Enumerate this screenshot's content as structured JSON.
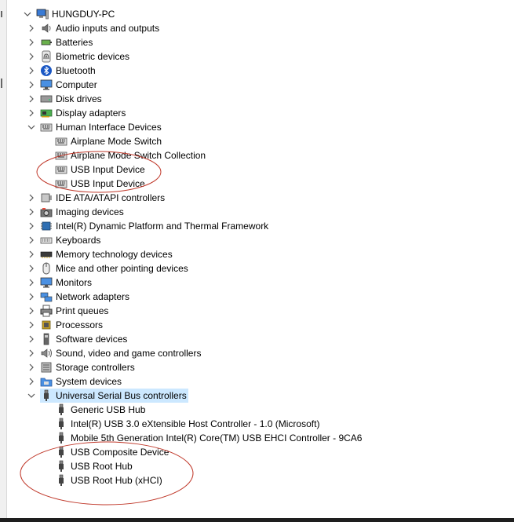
{
  "root": {
    "label": "HUNGDUY-PC",
    "icon": "computer-icon",
    "expanded": true
  },
  "categories": [
    {
      "label": "Audio inputs and outputs",
      "icon": "speaker-icon",
      "expanded": false
    },
    {
      "label": "Batteries",
      "icon": "battery-icon",
      "expanded": false
    },
    {
      "label": "Biometric devices",
      "icon": "fingerprint-icon",
      "expanded": false
    },
    {
      "label": "Bluetooth",
      "icon": "bluetooth-icon",
      "expanded": false
    },
    {
      "label": "Computer",
      "icon": "monitor-icon",
      "expanded": false
    },
    {
      "label": "Disk drives",
      "icon": "disk-drive-icon",
      "expanded": false
    },
    {
      "label": "Display adapters",
      "icon": "display-adapter-icon",
      "expanded": false
    },
    {
      "label": "Human Interface Devices",
      "icon": "hid-icon",
      "expanded": true,
      "children": [
        {
          "label": "Airplane Mode Switch",
          "icon": "hid-device-icon"
        },
        {
          "label": "Airplane Mode Switch Collection",
          "icon": "hid-device-icon"
        },
        {
          "label": "USB Input Device",
          "icon": "hid-device-icon"
        },
        {
          "label": "USB Input Device",
          "icon": "hid-device-icon"
        }
      ]
    },
    {
      "label": "IDE ATA/ATAPI controllers",
      "icon": "ide-controller-icon",
      "expanded": false
    },
    {
      "label": "Imaging devices",
      "icon": "camera-icon",
      "expanded": false
    },
    {
      "label": "Intel(R) Dynamic Platform and Thermal Framework",
      "icon": "chip-icon",
      "expanded": false
    },
    {
      "label": "Keyboards",
      "icon": "keyboard-icon",
      "expanded": false
    },
    {
      "label": "Memory technology devices",
      "icon": "memory-icon",
      "expanded": false
    },
    {
      "label": "Mice and other pointing devices",
      "icon": "mouse-icon",
      "expanded": false
    },
    {
      "label": "Monitors",
      "icon": "monitor-icon",
      "expanded": false
    },
    {
      "label": "Network adapters",
      "icon": "network-icon",
      "expanded": false
    },
    {
      "label": "Print queues",
      "icon": "printer-icon",
      "expanded": false
    },
    {
      "label": "Processors",
      "icon": "processor-icon",
      "expanded": false
    },
    {
      "label": "Software devices",
      "icon": "software-device-icon",
      "expanded": false
    },
    {
      "label": "Sound, video and game controllers",
      "icon": "sound-icon",
      "expanded": false
    },
    {
      "label": "Storage controllers",
      "icon": "storage-icon",
      "expanded": false
    },
    {
      "label": "System devices",
      "icon": "system-folder-icon",
      "expanded": false
    },
    {
      "label": "Universal Serial Bus controllers",
      "icon": "usb-icon",
      "expanded": true,
      "selected": true,
      "children": [
        {
          "label": "Generic USB Hub",
          "icon": "usb-plug-icon"
        },
        {
          "label": "Intel(R) USB 3.0 eXtensible Host Controller - 1.0 (Microsoft)",
          "icon": "usb-plug-icon"
        },
        {
          "label": "Mobile 5th Generation Intel(R) Core(TM) USB EHCI Controller - 9CA6",
          "icon": "usb-plug-icon"
        },
        {
          "label": "USB Composite Device",
          "icon": "usb-plug-icon"
        },
        {
          "label": "USB Root Hub",
          "icon": "usb-plug-icon"
        },
        {
          "label": "USB Root Hub (xHCI)",
          "icon": "usb-plug-icon"
        }
      ]
    }
  ],
  "colors": {
    "selection": "#cce8ff",
    "annotation": "#c0392b"
  }
}
